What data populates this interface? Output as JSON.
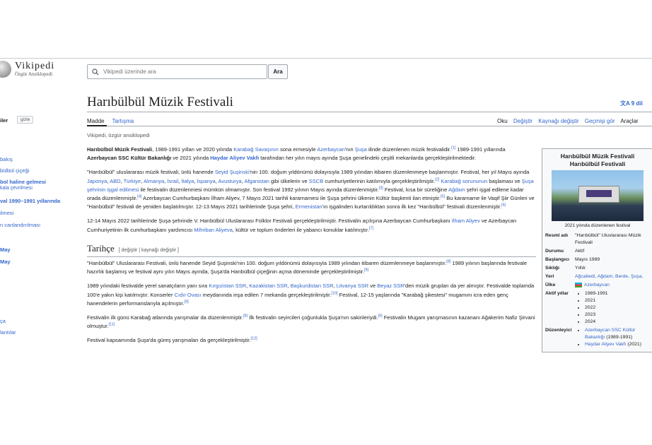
{
  "header": {
    "logo_title": "Vikipedi",
    "logo_subtitle": "Özgür Ansiklopedi",
    "search_placeholder": "Vikipedi üzerinde ara",
    "search_button": "Ara"
  },
  "sidebar": {
    "heading": "iler",
    "hide_button": "gizle",
    "items": [
      {
        "label": "bakış",
        "bold": false
      },
      {
        "label": "bülbül çiçeği",
        "bold": false
      },
      {
        "label": "bol haline gelmesi",
        "bold": true
      },
      {
        "label": "kala çevrilmesi",
        "bold": false
      },
      {
        "label": "val 1990–1991 yıllarında",
        "bold": true
      },
      {
        "label": "ilmesi",
        "bold": false
      },
      {
        "label": "n canlandırılması",
        "bold": false
      },
      {
        "label": "May",
        "bold": true
      },
      {
        "label": "May",
        "bold": true
      },
      {
        "label": "ça",
        "bold": false
      },
      {
        "label": "lantılar",
        "bold": false
      }
    ]
  },
  "page": {
    "title": "Harıbülbül Müzik Festivali",
    "languages": "9 dil",
    "tab_article": "Madde",
    "tab_talk": "Tartışma",
    "tab_read": "Oku",
    "tab_edit": "Değiştir",
    "tab_edit_source": "Kaynağı değiştir",
    "tab_history": "Geçmişi gör",
    "tab_tools": "Araçlar",
    "tagline": "Vikipedi, özgür ansiklopedi"
  },
  "article": {
    "p1": {
      "b1": "Harıbülbül Müzik Festivali",
      "t1": ", 1989-1991 yılları ve 2020 yılında ",
      "l1": "Karabağ Savaşının",
      "t2": " sona ermesiyle ",
      "l2": "Azerbaycan",
      "t3": "'nın ",
      "l3": "Şuşa",
      "t4": " ilinde düzenlenen müzik festivalidir.",
      "s1": "[1]",
      "t5": " 1989-1991 yıllarında ",
      "b2": "Azerbaycan SSC Kültür Bakanlığı",
      "t6": " ve 2021 yılında ",
      "b3": "Haydar Aliyev Vakfı",
      "t7": " tarafından her yılın mayıs ayında Şuşa genelindeki çeşitli mekanlarda gerçekleştirilmektedir."
    },
    "p2": {
      "t1": "\"Harıbülbül\" uluslararası müzik festivali, ünlü hanende ",
      "l1": "Seyid Şuşinski",
      "t2": "'nin 100. doğum yıldönümü dolayısıyla 1989 yılından itibaren düzenlenmeye başlanmıştır. Festival, her yıl Mayıs ayında ",
      "l2": "Japonya",
      "t3": ", ",
      "l3": "ABD",
      "t4": ", ",
      "l4": "Türkiye",
      "t5": ", ",
      "l5": "Almanya",
      "t6": ", ",
      "l6": "İsrail",
      "t7": ", ",
      "l7": "İtalya",
      "t8": ", ",
      "l8": "İspanya",
      "t9": ", ",
      "l9": "Avusturya",
      "t10": ", ",
      "l10": "Afganistan",
      "t11": " gibi ülkelerin ve ",
      "l11": "SSCB",
      "t12": " cumhuriyetlerinin katılımıyla gerçekleştirilmiştir.",
      "s1": "[2]",
      "t13": " ",
      "l12": "Karabağ sorununun",
      "t14": " başlaması ve ",
      "l13": "Şuşa şehrinin işgal edilmesi",
      "t15": " ile festivalin düzenlenmesi mümkün olmamıştır. Son festival 1992 yılının Mayıs ayında düzenlenmiştir.",
      "s2": "[3]",
      "t16": " Festival, kısa bir süreliğine ",
      "l14": "Ağdam",
      "t17": " şehri işgal edilene kadar orada düzenlenmiştir.",
      "s3": "[4]",
      "t18": " Azerbaycan Cumhurbaşkanı İlham Aliyev, 7 Mayıs 2021 tarihli kararnamesi ile Şuşa şehrini ülkenin Kültür başkenti ilan etmiştir.",
      "s4": "[5]",
      "t19": " Bu kararname ile Vaqif Şiir Günleri ve \"Harıbülbül\" festivali de yeniden başlatılmıştır. 12-13 Mayıs 2021 tarihlerinde Şuşa şehri, ",
      "l15": "Ermenistan",
      "t20": "'ın işgalinden kurtarıldıktan sonra ilk kez \"Harıbülbül\" festivali düzenlenmiştir.",
      "s5": "[6]"
    },
    "p3": {
      "t1": "12-14 Mayıs 2022 tarihlerinde Şuşa şehrinde V. Harıbülbül Uluslararası Folklor Festivali gerçekleştirilmiştir. Festivalin açılışına Azerbaycan Cumhurbaşkanı ",
      "l1": "İlham Aliyev",
      "t2": " ve Azerbaycan Cumhuriyetinin ilk cumhurbaşkanı yardımcısı ",
      "l2": "Mihriban Aliyeva",
      "t3": ", kültür ve toplum önderleri ile yabancı konuklar katılmıştır.",
      "s1": "[7]"
    },
    "h2": "Tarihçe",
    "h2_edit": "[ değiştir | kaynağı değiştir ]",
    "p4": {
      "t1": "\"Harıbülbül\" Uluslararası Festivali, ünlü hanende Seyid Şuşinski'nin 100. doğum yıldönümü dolayısıyla 1989 yılından itibaren düzenlenmeye başlanmıştır.",
      "s1": "[8]",
      "t2": " 1989 yılının başlarında festivale hazırlık başlamış ve festival aynı yılın Mayıs ayında, Şuşa'da Harıbülbül çiçeğinin açma döneminde gerçekleştirilmiştir.",
      "s2": "[9]"
    },
    "p5": {
      "t1": "1989 yılındaki festivalde yerel sanatçıların yanı sıra ",
      "l1": "Kırgızistan SSR",
      "t2": ", ",
      "l2": "Kazakistan SSR",
      "t3": ", ",
      "l3": "Başkurdistan SSR",
      "t4": ", ",
      "l4": "Litvanya SSR",
      "t5": " ve ",
      "l5": "Beyaz SSR",
      "t6": "'den müzik grupları da yer almıştır. Festivalde toplamda 100'e yakın kişi katılmıştır. Konserler ",
      "l6": "Cıdır Ovası",
      "t7": " meydanında inşa edilen 7 mekanda gerçekleştirilmiştir.",
      "s1": "[10]",
      "t8": " Festival, 12-15 yaşlarında \"Karabağ şikestesi\" mugamını icra eden genç hanendelerin performanslarıyla açılmıştır.",
      "s2": "[9]"
    },
    "p6": {
      "t1": "Festivalin ilk günü Karabağ atlarında yarışmalar da düzenlenmiştir.",
      "s1": "[8]",
      "t2": " İlk festivalin seyircileri çoğunlukla Şuşa'nın sakinleriydi.",
      "s2": "[9]",
      "t3": " Festivalin Mugam yarışmasının kazananı Ağakerim Nafiz Şirvani olmuştur.",
      "s3": "[11]"
    },
    "p7": {
      "t1": "Festival kapsamında Şuşa'da güreş yarışmaları da gerçekleştirilmiştir.",
      "s1": "[12]"
    }
  },
  "infobox": {
    "title1": "Harıbülbül Müzik Festivali",
    "title2": "Harıbülbül Festivali",
    "caption": "2021 yılında düzenlenen festival",
    "rows": {
      "official_label": "Resmî adı",
      "official_value": "\"Harıbülbül\" Uluslararası Müzik Festivali",
      "status_label": "Durumu",
      "status_value": "Aktif",
      "start_label": "Başlangıcı",
      "start_value": "Mayıs 1989",
      "freq_label": "Sıklığı",
      "freq_value": "Yıllık",
      "venue_label": "Yeri",
      "venue_value": "Ağcabedi, Ağdam, Berde, Şuşa,",
      "country_label": "Ülke",
      "country_value": "Azerbaycan",
      "years_label": "Aktif yıllar",
      "years": [
        "1989-1991",
        "2021",
        "2022",
        "2023",
        "2024"
      ],
      "org_label": "Düzenleyici",
      "org1_link": "Azerbaycan SSC Kültür Bakanlığı",
      "org1_years": "(1989-1991)",
      "org2_link": "Haydar Aliyev Vakfı",
      "org2_years": "(2021)"
    }
  }
}
